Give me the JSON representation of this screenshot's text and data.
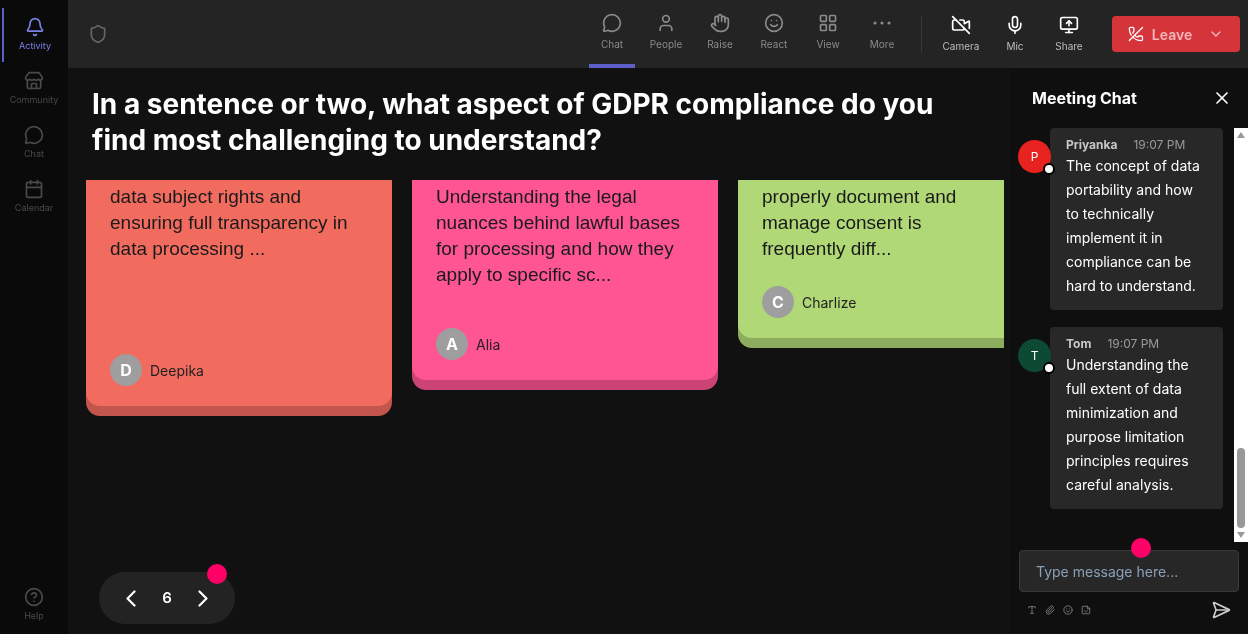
{
  "sidebar": {
    "items": [
      {
        "label": "Activity",
        "selected": true
      },
      {
        "label": "Community",
        "selected": false
      },
      {
        "label": "Chat",
        "selected": false
      },
      {
        "label": "Calendar",
        "selected": false
      }
    ],
    "help": {
      "label": "Help"
    }
  },
  "toolbar": {
    "items": [
      {
        "label": "Chat",
        "selected": true
      },
      {
        "label": "People",
        "selected": false
      },
      {
        "label": "Raise",
        "selected": false
      },
      {
        "label": "React",
        "selected": false
      },
      {
        "label": "View",
        "selected": false
      },
      {
        "label": "More",
        "selected": false
      }
    ],
    "devices": [
      {
        "label": "Camera"
      },
      {
        "label": "Mic"
      },
      {
        "label": "Share"
      }
    ],
    "leave": "Leave"
  },
  "question": "In a sentence or two, what aspect of GDPR compliance do you find most challenging to understand?",
  "cards": [
    {
      "text": "data subject rights and ensuring full transparency in data processing ...",
      "author": "Deepika",
      "initial": "D",
      "color": "#f26b5f"
    },
    {
      "text": "Understanding the legal nuances behind lawful bases for processing and how they apply to specific sc...",
      "author": "Alia",
      "initial": "A",
      "color": "#ff5592"
    },
    {
      "text": "properly document and manage consent is frequently diff...",
      "author": "Charlize",
      "initial": "C",
      "color": "#b0d876"
    }
  ],
  "pager": {
    "page": "6"
  },
  "chat": {
    "title": "Meeting Chat",
    "messages": [
      {
        "author": "Priyanka",
        "initial": "P",
        "color": "#e8221f",
        "time": "19:07 PM",
        "text": "The concept of data portability and how to technically implement it in compliance can be hard to understand."
      },
      {
        "author": "Tom",
        "initial": "T",
        "color": "#0d4a33",
        "time": "19:07 PM",
        "text": "Understanding the full extent of data minimization and purpose limitation principles requires careful analysis."
      }
    ],
    "input": {
      "placeholder": "Type message here..."
    }
  }
}
